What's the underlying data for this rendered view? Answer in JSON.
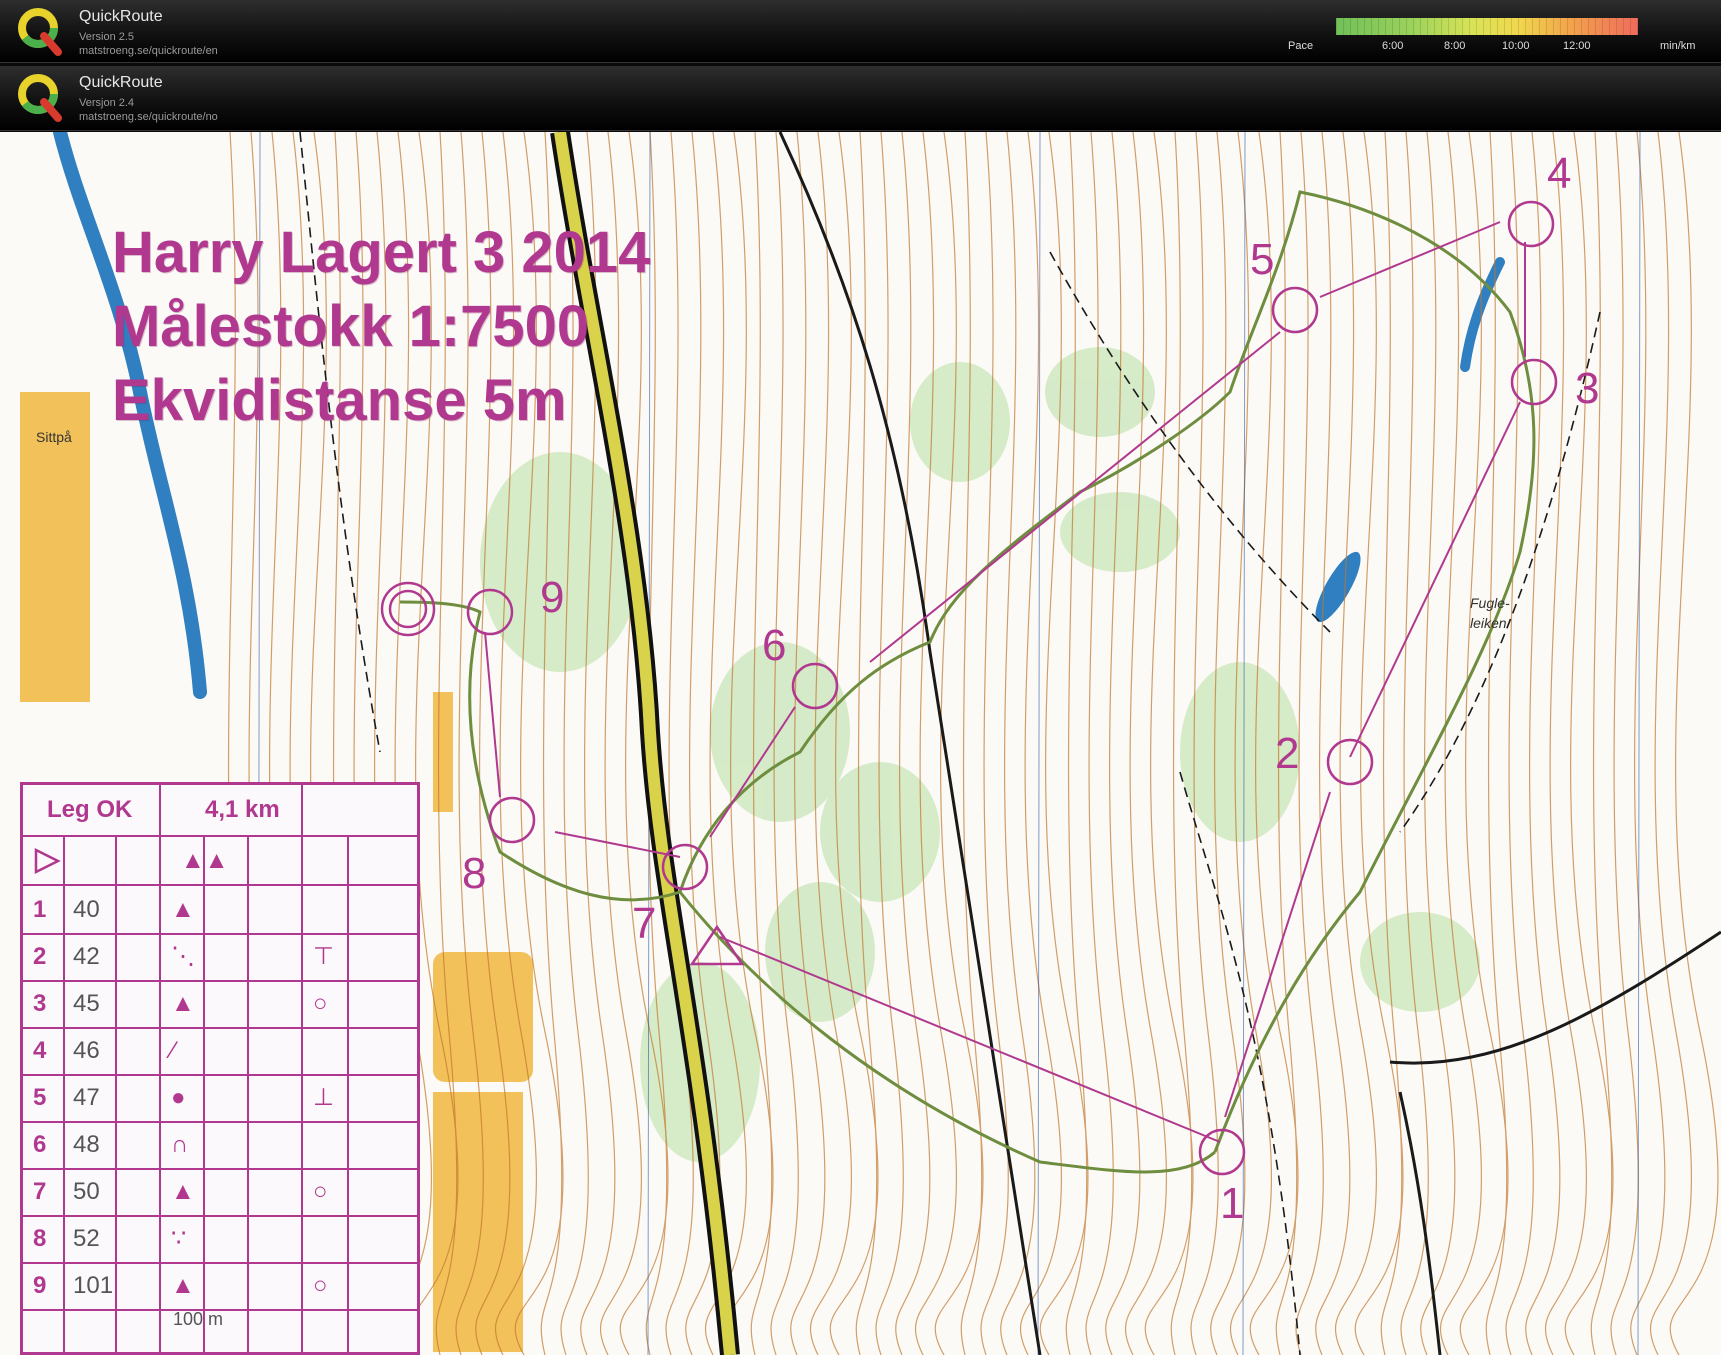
{
  "window_bars": [
    {
      "title": "QuickRoute",
      "version": "Version 2.5",
      "url": "matstroeng.se/quickroute/en"
    },
    {
      "title": "QuickRoute",
      "version": "Versjon 2.4",
      "url": "matstroeng.se/quickroute/no"
    }
  ],
  "pace": {
    "label": "Pace",
    "ticks": [
      "6:00",
      "8:00",
      "10:00",
      "12:00"
    ],
    "unit": "min/km"
  },
  "map": {
    "title_lines": [
      "Harry Lagert 3 2014",
      "Målestokk 1:7500",
      "Ekvidistanse 5m"
    ],
    "place_names": [
      "Sittpå",
      "Fugle-",
      "leiken"
    ],
    "control_labels": [
      "1",
      "2",
      "3",
      "4",
      "5",
      "6",
      "7",
      "8",
      "9"
    ]
  },
  "control_description": {
    "header": {
      "name": "Leg OK",
      "length": "4,1 km"
    },
    "rows": [
      {
        "num": "1",
        "code": "40",
        "symbol": "▲",
        "extra": ""
      },
      {
        "num": "2",
        "code": "42",
        "symbol": "⋱",
        "extra": "⊤"
      },
      {
        "num": "3",
        "code": "45",
        "symbol": "▲",
        "extra": "○"
      },
      {
        "num": "4",
        "code": "46",
        "symbol": "⁄",
        "extra": ""
      },
      {
        "num": "5",
        "code": "47",
        "symbol": "●",
        "extra": "⊥"
      },
      {
        "num": "6",
        "code": "48",
        "symbol": "∩",
        "extra": ""
      },
      {
        "num": "7",
        "code": "50",
        "symbol": "▲",
        "extra": "○"
      },
      {
        "num": "8",
        "code": "52",
        "symbol": "∵",
        "extra": ""
      },
      {
        "num": "9",
        "code": "101",
        "symbol": "▲",
        "extra": "○"
      }
    ],
    "footer": "100 m"
  },
  "colors": {
    "course": "#b0398f",
    "route": "#6e8d3e",
    "road": "#1a1a1a"
  }
}
